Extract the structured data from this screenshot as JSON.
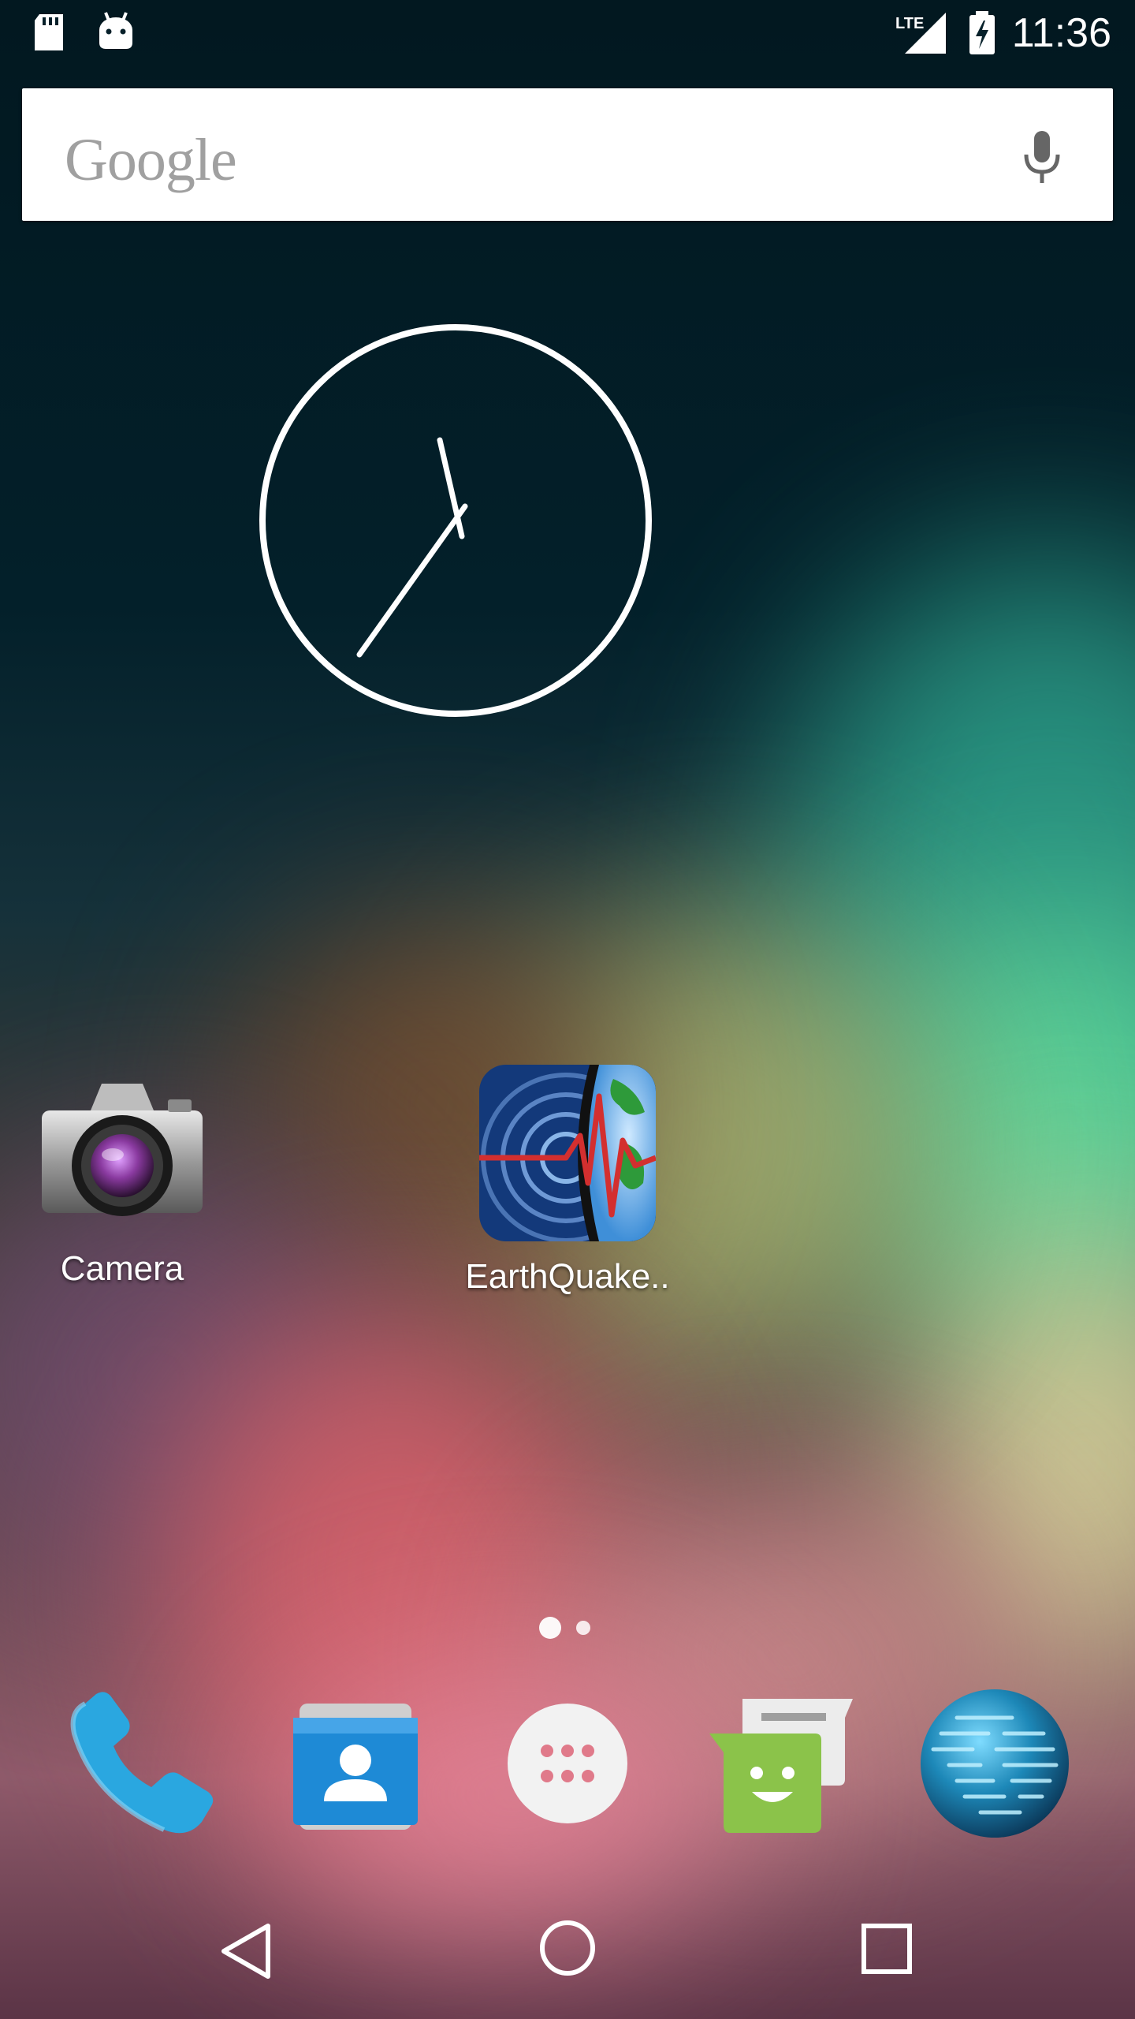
{
  "status_bar": {
    "time": "11:36",
    "left_icons": [
      "sd-card-icon",
      "android-debug-icon"
    ],
    "right_icons": [
      "lte-signal-icon",
      "battery-charging-icon"
    ],
    "network_label": "LTE"
  },
  "search_bar": {
    "logo_text": "Google",
    "voice_icon": "mic-icon"
  },
  "clock_widget": {
    "type": "analog",
    "time_shown": "11:36"
  },
  "home_apps": [
    {
      "label": "Camera",
      "icon": "camera-icon"
    },
    {
      "label": "EarthQuake..",
      "icon": "earthquake-icon"
    }
  ],
  "page_indicator": {
    "pages": 2,
    "current": 1
  },
  "dock": [
    {
      "name": "Phone",
      "icon": "phone-icon"
    },
    {
      "name": "Contacts",
      "icon": "contacts-icon"
    },
    {
      "name": "All apps",
      "icon": "app-drawer-icon"
    },
    {
      "name": "Messaging",
      "icon": "messaging-icon"
    },
    {
      "name": "Browser",
      "icon": "globe-icon"
    }
  ],
  "nav_bar": [
    "back-icon",
    "home-icon",
    "recents-icon"
  ],
  "colors": {
    "search_background": "#ffffff",
    "phone_blue": "#2aa7e0",
    "contacts_blue": "#1e8ad6",
    "messaging_green": "#8bc34a",
    "earthquake_red": "#d32f2f"
  }
}
